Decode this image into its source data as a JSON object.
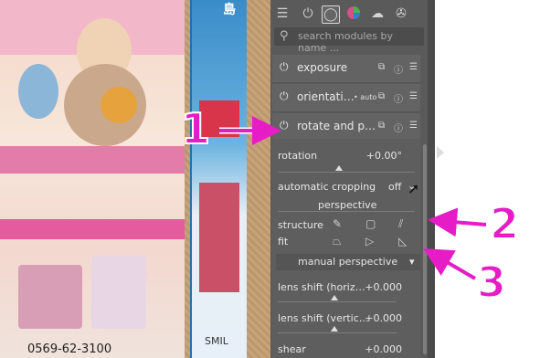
{
  "photo": {
    "texts": [
      "島",
      "0569-62-3100",
      "SMIL"
    ]
  },
  "toolbar": {
    "icons": [
      "sliders-icon",
      "power-icon",
      "circle-icon",
      "color-wheel-icon",
      "cloud-icon",
      "film-reel-icon"
    ],
    "active_index": 2
  },
  "search": {
    "placeholder": "search modules by name ..."
  },
  "modules": [
    {
      "name": "exposure",
      "auto": ""
    },
    {
      "name": "orientati…",
      "auto": "• auto"
    },
    {
      "name": "rotate and p…",
      "auto": ""
    }
  ],
  "rotate": {
    "rotation_label": "rotation",
    "rotation_value": "+0.00°",
    "autocrop_label": "automatic cropping",
    "autocrop_value": "off",
    "perspective_header": "perspective",
    "structure_label": "structure",
    "fit_label": "fit",
    "manual_header": "manual perspective",
    "lens_h_label": "lens shift (horiz…",
    "lens_h_value": "+0.000",
    "lens_v_label": "lens shift (vertic…",
    "lens_v_value": "+0.000",
    "shear_label": "shear",
    "shear_value": "+0.000"
  },
  "annotations": {
    "n1": "1",
    "n2": "2",
    "n3": "3",
    "color": "#e61cc6"
  }
}
